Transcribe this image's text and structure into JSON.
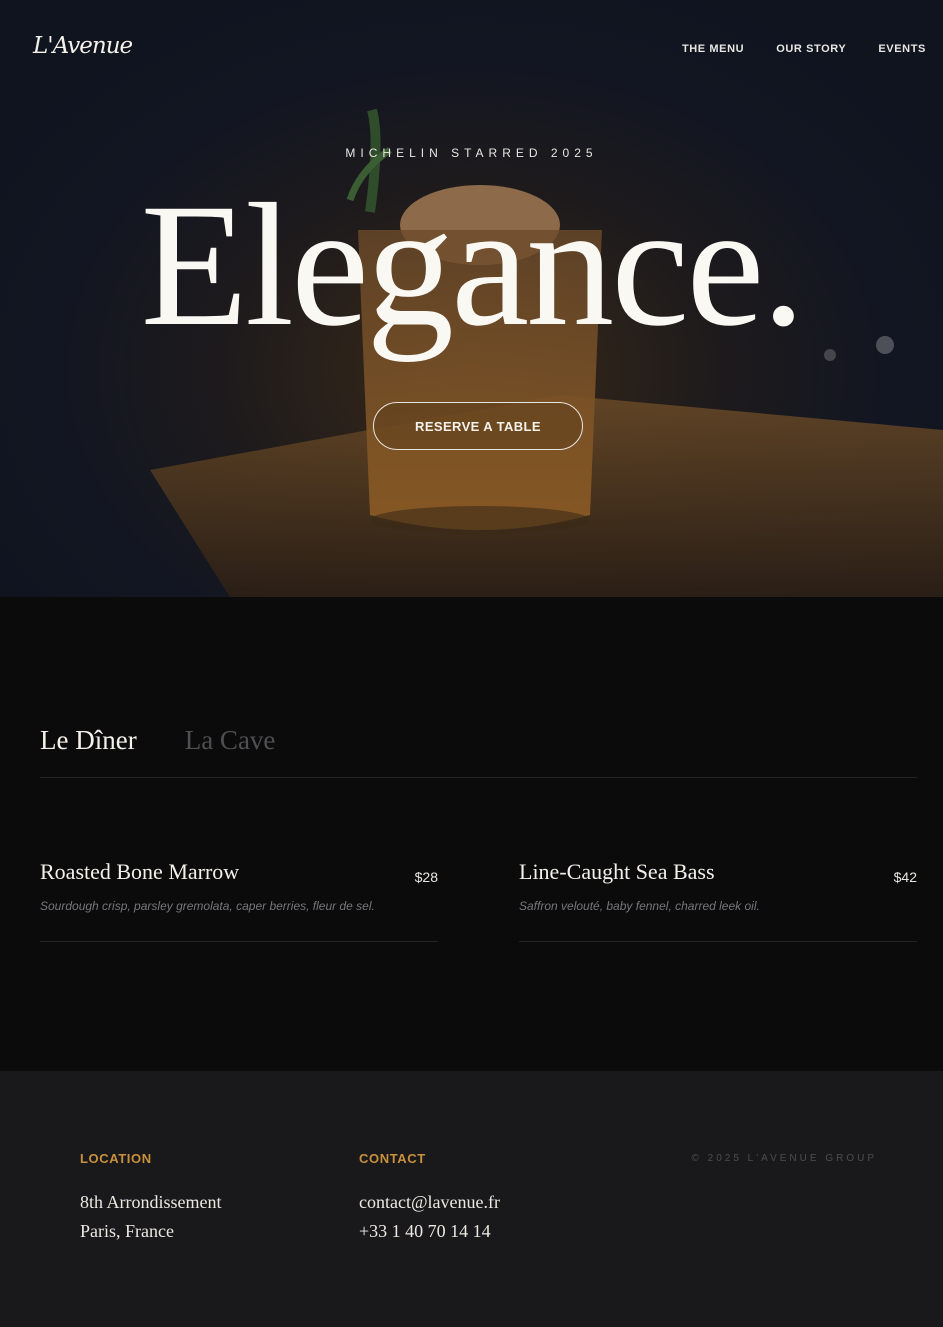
{
  "nav": {
    "logo": "L'Avenue",
    "links": [
      "THE MENU",
      "OUR STORY",
      "EVENTS"
    ]
  },
  "hero": {
    "kicker": "MICHELIN STARRED 2025",
    "headline": "Elegance.",
    "cta": "RESERVE A TABLE"
  },
  "menu": {
    "tabs": [
      "Le Dîner",
      "La Cave"
    ],
    "active_tab": "Le Dîner",
    "items": [
      {
        "name": "Roasted Bone Marrow",
        "price": "$28",
        "description": "Sourdough crisp, parsley gremolata, caper berries, fleur de sel."
      },
      {
        "name": "Line-Caught Sea Bass",
        "price": "$42",
        "description": "Saffron velouté, baby fennel, charred leek oil."
      }
    ]
  },
  "footer": {
    "location": {
      "heading": "LOCATION",
      "lines": [
        "8th Arrondissement",
        "Paris, France"
      ]
    },
    "contact": {
      "heading": "CONTACT",
      "lines": [
        "contact@lavenue.fr",
        "+33 1 40 70 14 14"
      ]
    },
    "copyright": "© 2025 L'AVENUE GROUP"
  },
  "colors": {
    "accent": "#c9903d",
    "background": "#0b0b0c",
    "footer": "#19191b"
  }
}
